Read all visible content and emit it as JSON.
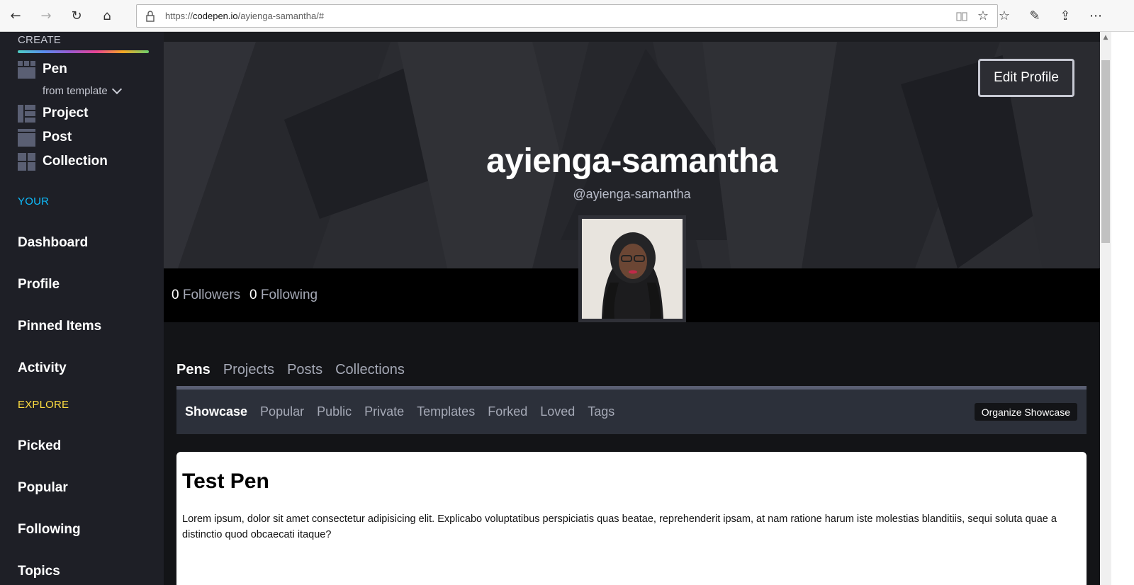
{
  "browser": {
    "url_prefix": "https://",
    "url_domain": "codepen.io",
    "url_path": "/ayienga-samantha/#"
  },
  "sidebar": {
    "create_label": "CREATE",
    "create_items": [
      {
        "label": "Pen",
        "icon": "pen-icon"
      },
      {
        "label": "Project",
        "icon": "project-icon"
      },
      {
        "label": "Post",
        "icon": "post-icon"
      },
      {
        "label": "Collection",
        "icon": "collection-icon"
      }
    ],
    "from_template": "from template",
    "your_label": "YOUR",
    "your_items": [
      "Dashboard",
      "Profile",
      "Pinned Items",
      "Activity"
    ],
    "explore_label": "EXPLORE",
    "explore_items": [
      "Picked",
      "Popular",
      "Following",
      "Topics"
    ],
    "colors": {
      "your": "#47cf73",
      "your_label": "#0ebeff",
      "explore": "#ffdd40"
    }
  },
  "profile": {
    "edit_button": "Edit Profile",
    "name": "ayienga-samantha",
    "handle": "@ayienga-samantha",
    "followers_count": "0",
    "followers_label": "Followers",
    "following_count": "0",
    "following_label": "Following"
  },
  "tabs": [
    "Pens",
    "Projects",
    "Posts",
    "Collections"
  ],
  "subtabs": [
    "Showcase",
    "Popular",
    "Public",
    "Private",
    "Templates",
    "Forked",
    "Loved",
    "Tags"
  ],
  "organize_button": "Organize Showcase",
  "card": {
    "title": "Test Pen",
    "body": "Lorem ipsum, dolor sit amet consectetur adipisicing elit. Explicabo voluptatibus perspiciatis quas beatae, reprehenderit ipsam, at nam ratione harum iste molestias blanditiis, sequi soluta quae a distinctio quod obcaecati itaque?"
  }
}
